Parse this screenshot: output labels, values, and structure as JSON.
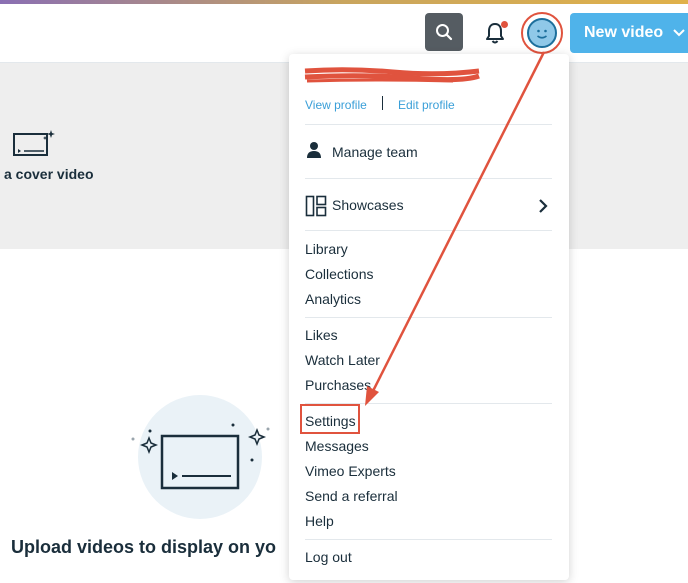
{
  "header": {
    "new_video_label": "New video"
  },
  "banner": {
    "text": "a cover video"
  },
  "main": {
    "upload_title": "Upload videos to display on yo"
  },
  "menu": {
    "view_profile": "View profile",
    "edit_profile": "Edit profile",
    "manage_team": "Manage team",
    "showcases": "Showcases",
    "library": "Library",
    "collections": "Collections",
    "analytics": "Analytics",
    "likes": "Likes",
    "watch_later": "Watch Later",
    "purchases": "Purchases",
    "settings": "Settings",
    "messages": "Messages",
    "vimeo_experts": "Vimeo Experts",
    "send_referral": "Send a referral",
    "help": "Help",
    "log_out": "Log out"
  },
  "colors": {
    "accent": "#4fb3ea",
    "annotation": "#e0533e",
    "link": "#3a9fd8",
    "text": "#1a2e3b"
  }
}
